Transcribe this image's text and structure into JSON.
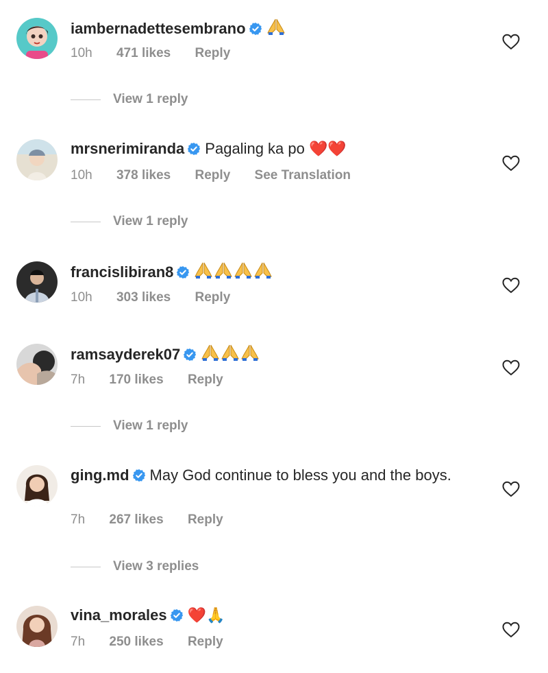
{
  "accent_verified": "#3897f0",
  "muted_text": "#8e8e8e",
  "comments": [
    {
      "username": "iambernadettesembrano",
      "verified": true,
      "text": "",
      "emojis": "🙏",
      "time": "10h",
      "likes": "471 likes",
      "reply": "Reply",
      "view_replies": "View 1 reply"
    },
    {
      "username": "mrsnerimiranda",
      "verified": true,
      "text": "Pagaling ka po",
      "emojis": "❤️❤️",
      "time": "10h",
      "likes": "378 likes",
      "reply": "Reply",
      "see_translation": "See Translation",
      "view_replies": "View 1 reply"
    },
    {
      "username": "francislibiran8",
      "verified": true,
      "text": "",
      "emojis": "🙏🙏🙏🙏",
      "time": "10h",
      "likes": "303 likes",
      "reply": "Reply"
    },
    {
      "username": "ramsayderek07",
      "verified": true,
      "text": "",
      "emojis": "🙏🙏🙏",
      "time": "7h",
      "likes": "170 likes",
      "reply": "Reply",
      "view_replies": "View 1 reply"
    },
    {
      "username": "ging.md",
      "verified": true,
      "text": "May God continue to bless you and the boys.",
      "emojis": "",
      "time": "7h",
      "likes": "267 likes",
      "reply": "Reply",
      "view_replies": "View 3 replies"
    },
    {
      "username": "vina_morales",
      "verified": true,
      "text": "",
      "emojis": "❤️🙏",
      "time": "7h",
      "likes": "250 likes",
      "reply": "Reply"
    }
  ]
}
